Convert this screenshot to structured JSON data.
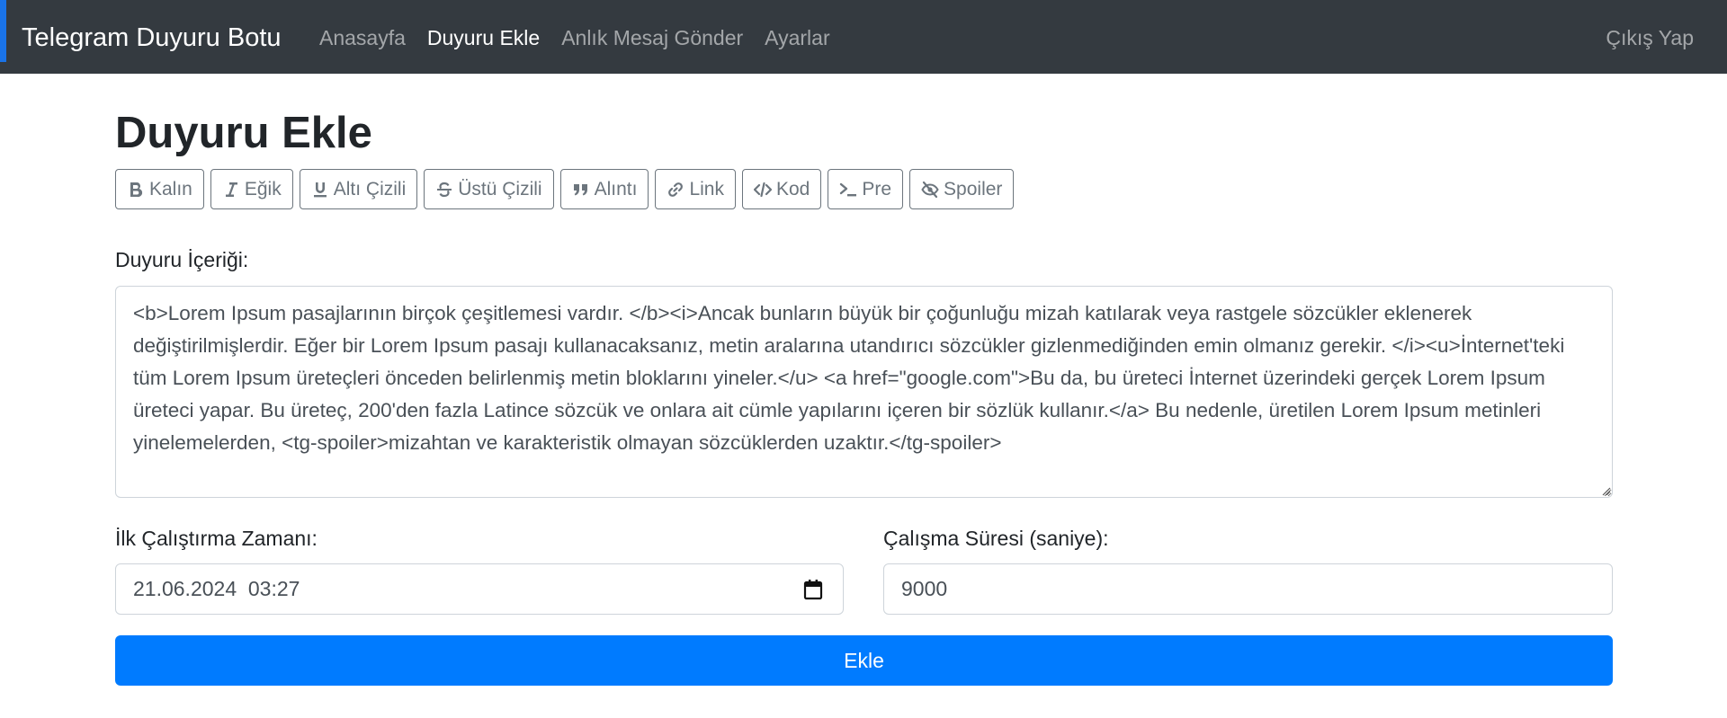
{
  "navbar": {
    "brand": "Telegram Duyuru Botu",
    "links": [
      {
        "label": "Anasayfa",
        "active": false
      },
      {
        "label": "Duyuru Ekle",
        "active": true
      },
      {
        "label": "Anlık Mesaj Gönder",
        "active": false
      },
      {
        "label": "Ayarlar",
        "active": false
      }
    ],
    "logout": "Çıkış Yap",
    "background_color": "#343a40",
    "accent_color": "#1a73e8"
  },
  "page": {
    "title": "Duyuru Ekle"
  },
  "toolbar": {
    "buttons": [
      {
        "label": "Kalın",
        "icon": "bold-icon"
      },
      {
        "label": "Eğik",
        "icon": "italic-icon"
      },
      {
        "label": "Altı Çizili",
        "icon": "underline-icon"
      },
      {
        "label": "Üstü Çizili",
        "icon": "strikethrough-icon"
      },
      {
        "label": "Alıntı",
        "icon": "quote-icon"
      },
      {
        "label": "Link",
        "icon": "link-icon"
      },
      {
        "label": "Kod",
        "icon": "code-icon"
      },
      {
        "label": "Pre",
        "icon": "terminal-icon"
      },
      {
        "label": "Spoiler",
        "icon": "eye-slash-icon"
      }
    ]
  },
  "form": {
    "content_label": "Duyuru İçeriği:",
    "content_value": "<b>Lorem Ipsum pasajlarının birçok çeşitlemesi vardır. </b><i>Ancak bunların büyük bir çoğunluğu mizah katılarak veya rastgele sözcükler eklenerek değiştirilmişlerdir. Eğer bir Lorem Ipsum pasajı kullanacaksanız, metin aralarına utandırıcı sözcükler gizlenmediğinden emin olmanız gerekir. </i><u>İnternet'teki tüm Lorem Ipsum üreteçleri önceden belirlenmiş metin bloklarını yineler.</u> <a href=\"google.com\">Bu da, bu üreteci İnternet üzerindeki gerçek Lorem Ipsum üreteci yapar. Bu üreteç, 200'den fazla Latince sözcük ve onlara ait cümle yapılarını içeren bir sözlük kullanır.</a> Bu nedenle, üretilen Lorem Ipsum metinleri yinelemelerden, <tg-spoiler>mizahtan ve karakteristik olmayan sözcüklerden uzaktır.</tg-spoiler>",
    "first_run_label": "İlk Çalıştırma Zamanı:",
    "first_run_value": "21.06.2024  03:27",
    "duration_label": "Çalışma Süresi (saniye):",
    "duration_value": "9000",
    "submit_label": "Ekle",
    "submit_color": "#007bff"
  }
}
